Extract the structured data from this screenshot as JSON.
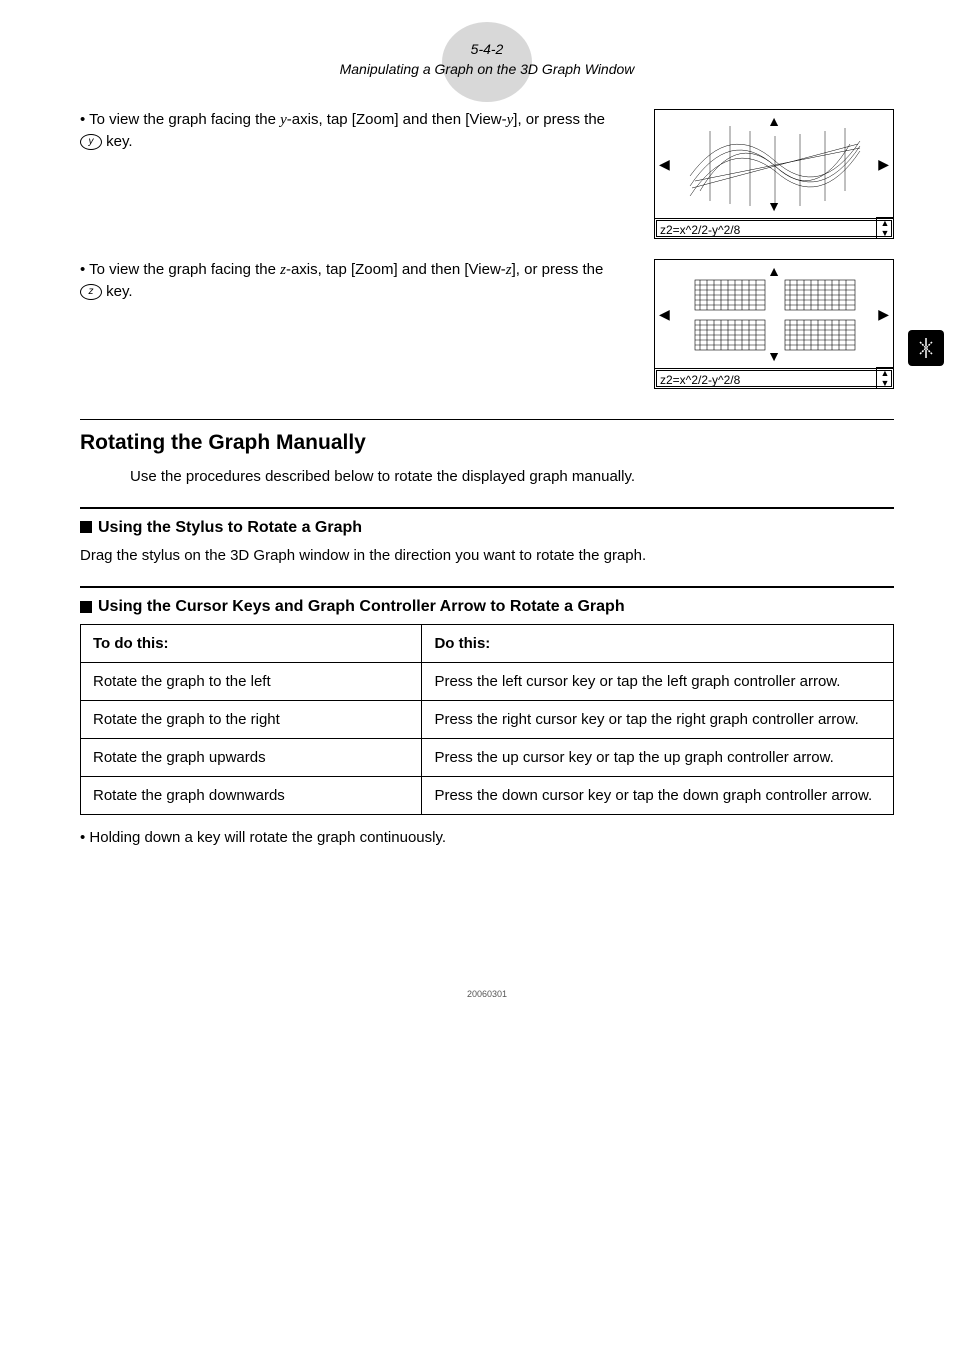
{
  "header": {
    "pageNum": "5-4-2",
    "title": "Manipulating a Graph on the 3D Graph Window"
  },
  "bullets": {
    "y": {
      "prefix": "• To view the graph facing the ",
      "axis": "y",
      "mid": "-axis, tap [Zoom] and then [View-",
      "axis2": "y",
      "suffix": "], or press the ",
      "keyLabel": "y",
      "end": " key."
    },
    "z": {
      "prefix": "• To view the graph facing the ",
      "axis": "z",
      "mid": "-axis, tap [Zoom] and then [View-",
      "axis2": "z",
      "suffix": "], or press the ",
      "keyLabel": "z",
      "end": " key."
    }
  },
  "graphLabel": "z2=x^2/2-y^2/8",
  "section": {
    "title": "Rotating the Graph Manually",
    "body": "Use the procedures described below to rotate the displayed graph manually."
  },
  "sub1": {
    "title": "Using the Stylus to Rotate a Graph",
    "body": "Drag the stylus on the 3D Graph window in the direction you want to rotate the graph."
  },
  "sub2": {
    "title": "Using the Cursor Keys and Graph Controller Arrow to Rotate a Graph"
  },
  "table": {
    "head": {
      "c1": "To do this:",
      "c2": "Do this:"
    },
    "rows": [
      {
        "c1": "Rotate the graph to the left",
        "c2": "Press the left cursor key or tap the left graph controller arrow."
      },
      {
        "c1": "Rotate the graph to the right",
        "c2": "Press the right cursor key or tap the right graph controller arrow."
      },
      {
        "c1": "Rotate the graph upwards",
        "c2": "Press the up cursor key or tap the up graph controller arrow."
      },
      {
        "c1": "Rotate the graph downwards",
        "c2": "Press the down cursor key or tap the down graph controller arrow."
      }
    ]
  },
  "footnote": "• Holding down a key will rotate the graph continuously.",
  "stamp": "20060301",
  "chart_data": [
    {
      "type": "surface-view",
      "equation": "z2 = x^2/2 - y^2/8",
      "view_axis": "y",
      "arrows": [
        "up",
        "down",
        "left",
        "right"
      ]
    },
    {
      "type": "surface-view",
      "equation": "z2 = x^2/2 - y^2/8",
      "view_axis": "z",
      "arrows": [
        "up",
        "down",
        "left",
        "right"
      ]
    }
  ]
}
